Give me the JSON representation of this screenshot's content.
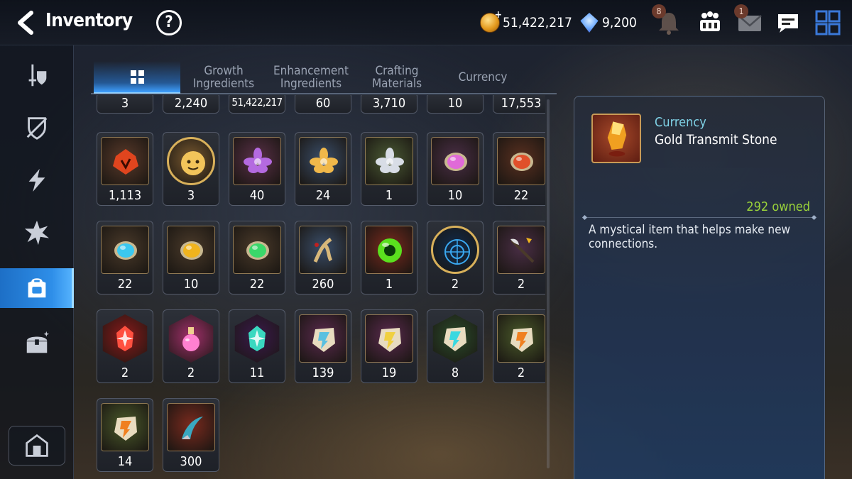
{
  "header": {
    "title": "Inventory",
    "help_label": "?",
    "gold": "51,422,217",
    "crystals": "9,200",
    "plus": "+",
    "notifications_badge": "8",
    "mail_badge": "1"
  },
  "tabs": [
    {
      "label": "",
      "active": true
    },
    {
      "label": "Growth\nIngredients"
    },
    {
      "label": "Enhancement\nIngredients"
    },
    {
      "label": "Crafting\nMaterials"
    },
    {
      "label": "Currency"
    }
  ],
  "inventory": {
    "partial_row": [
      "3",
      "2,240",
      "51,422,217",
      "60",
      "3,710",
      "10",
      "17,553"
    ],
    "rows": [
      [
        "1,113",
        "3",
        "40",
        "24",
        "1",
        "10",
        "22"
      ],
      [
        "22",
        "10",
        "22",
        "260",
        "1",
        "2",
        "2"
      ],
      [
        "2",
        "2",
        "11",
        "139",
        "19",
        "8",
        "2"
      ],
      [
        "14",
        "300"
      ]
    ]
  },
  "detail": {
    "category": "Currency",
    "name": "Gold Transmit Stone",
    "owned": "292 owned",
    "description": "A mystical item that helps make new connections."
  },
  "colors": {
    "accent": "#2e8ee8",
    "owned_green": "#9ad33a",
    "category_cyan": "#7fd2e6",
    "frame_gold": "#c99a56"
  },
  "icons": {
    "sidebar": [
      "sword-shield-icon",
      "broken-shield-icon",
      "lightning-icon",
      "burst-icon",
      "backpack-icon",
      "chest-icon"
    ],
    "home": "house-icon"
  }
}
